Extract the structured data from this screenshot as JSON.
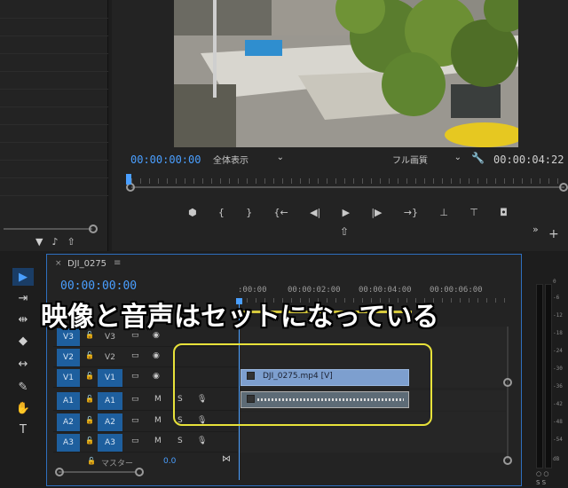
{
  "monitor": {
    "timecode_current": "00:00:00:00",
    "fit_select": "全体表示",
    "quality_select": "フル画質",
    "timecode_duration": "00:00:04:22",
    "transport": {
      "marker": "⬤",
      "in": "{",
      "out": "}",
      "goto_in": "{←",
      "step_back": "◀|",
      "play": "▶",
      "step_fwd": "|▶",
      "goto_out": "→}",
      "lift": "⊥",
      "extract": "⊤",
      "camera": "◘"
    },
    "export_frame": "⇧",
    "more": "»",
    "add": "+"
  },
  "left_panel": {
    "icons": [
      "▼",
      "♪",
      "⇧"
    ]
  },
  "tools": [
    "▶",
    "⇥",
    "⇹",
    "◆",
    "↔",
    "✎",
    "✋",
    "T"
  ],
  "timeline": {
    "close": "×",
    "title": "DJI_0275",
    "menu": "≡",
    "timecode": "00:00:00:00",
    "ruler_labels": [
      ":00:00",
      "00:00:02:00",
      "00:00:04:00",
      "00:00:06:00"
    ],
    "tracks": [
      {
        "src": "V3",
        "target": "V3",
        "target_on": false,
        "ctl1": "▭",
        "ctl2": "◉",
        "ctl3": ""
      },
      {
        "src": "V2",
        "target": "V2",
        "target_on": false,
        "ctl1": "▭",
        "ctl2": "◉",
        "ctl3": ""
      },
      {
        "src": "V1",
        "target": "V1",
        "target_on": true,
        "ctl1": "▭",
        "ctl2": "◉",
        "ctl3": ""
      },
      {
        "src": "A1",
        "target": "A1",
        "target_on": true,
        "ctl1": "▭",
        "ctl2": "M",
        "ctl3": "S"
      },
      {
        "src": "A2",
        "target": "A2",
        "target_on": true,
        "ctl1": "▭",
        "ctl2": "M",
        "ctl3": "S"
      },
      {
        "src": "A3",
        "target": "A3",
        "target_on": true,
        "ctl1": "▭",
        "ctl2": "M",
        "ctl3": "S"
      }
    ],
    "lock_icon": "🔒",
    "mic_icon": "🎙",
    "video_clip_label": "DJI_0275.mp4 [V]",
    "master_label": "マスター",
    "master_value": "0.0",
    "master_icon": "⋈"
  },
  "caption": "映像と音声はセットになっている",
  "meter": {
    "labels": [
      "0",
      "-6",
      "-12",
      "-18",
      "-24",
      "-30",
      "-36",
      "-42",
      "-48",
      "-54",
      "dB"
    ],
    "solo": "○ ○",
    "ss": "S S"
  },
  "colors": {
    "accent_blue": "#4a9fff",
    "track_blue": "#1e5f9e",
    "highlight_yellow": "#e8e23a",
    "video_clip": "#7d9fcf"
  }
}
